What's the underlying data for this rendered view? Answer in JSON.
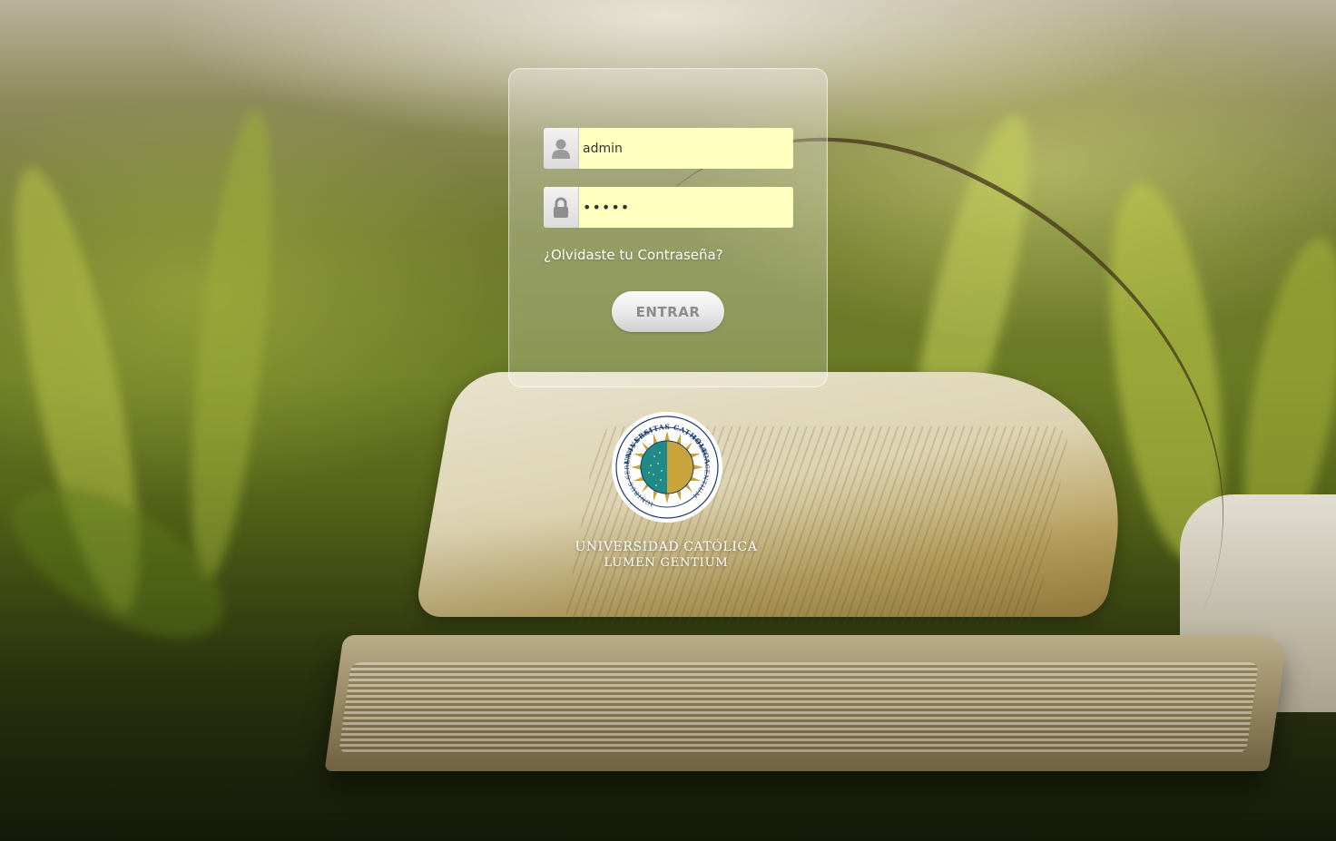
{
  "login": {
    "username_value": "admin",
    "password_value": "•••••",
    "forgot_password_link": "¿Olvidaste tu Contraseña?",
    "submit_label": "ENTRAR"
  },
  "branding": {
    "university_name": "UNIVERSIDAD CATÓLICA",
    "university_motto": "LUMEN GENTIUM",
    "seal_text_top": "UNIVERSITAS CATHOLICA",
    "seal_text_right": "LUMEN GENTIUM",
    "seal_text_left": "IGNIBUS SERAMUS VERA"
  },
  "icons": {
    "username": "user-icon",
    "password": "lock-icon",
    "seal": "university-seal-icon"
  },
  "colors": {
    "input_background": "#ffffc0",
    "seal_teal": "#1f8a86",
    "seal_gold": "#c8a43a",
    "seal_navy": "#1d3a6a"
  }
}
